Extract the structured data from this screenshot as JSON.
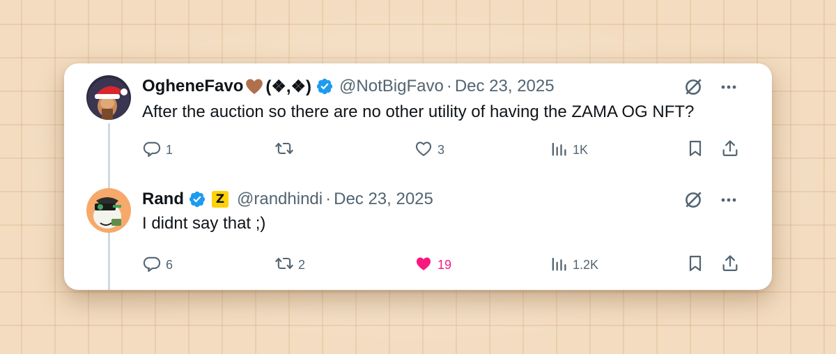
{
  "tweets": [
    {
      "display_name": "OgheneFavo",
      "name_suffix": "(❖,❖)",
      "handle": "@NotBigFavo",
      "separator": "·",
      "date": "Dec 23, 2025",
      "text": "After the auction so there are no other utility of having the ZAMA OG NFT?",
      "replies": "1",
      "retweets": "",
      "likes": "3",
      "views": "1K",
      "liked": false,
      "avatar": "santa-hat-avatar"
    },
    {
      "display_name": "Rand",
      "badge": "Z",
      "handle": "@randhindi",
      "separator": "·",
      "date": "Dec 23, 2025",
      "text": "I didnt say that ;)",
      "replies": "6",
      "retweets": "2",
      "likes": "19",
      "views": "1.2K",
      "liked": true,
      "avatar": "green-character-avatar"
    }
  ],
  "colors": {
    "verified": "#1d9bf0",
    "like_active": "#f91880",
    "muted_text": "#536471",
    "primary_text": "#0f1419",
    "badge_yellow": "#ffd208"
  },
  "icons": [
    "reply-icon",
    "retweet-icon",
    "like-icon",
    "views-icon",
    "bookmark-icon",
    "share-icon",
    "grok-icon",
    "more-icon",
    "verified-badge-icon",
    "brown-heart-emoji"
  ]
}
